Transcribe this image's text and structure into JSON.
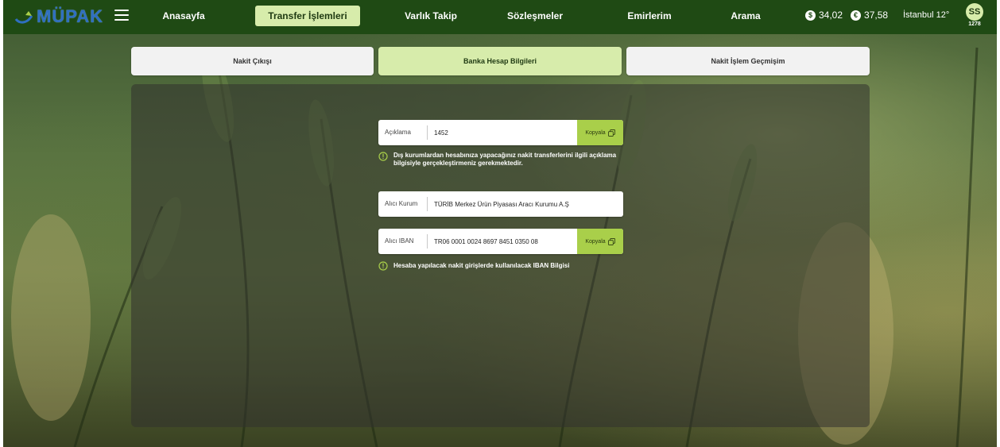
{
  "app": {
    "logo_text": "MÜPAK"
  },
  "nav": {
    "items": [
      {
        "label": "Anasayfa",
        "active": false
      },
      {
        "label": "Transfer İşlemleri",
        "active": true
      },
      {
        "label": "Varlık Takip",
        "active": false
      },
      {
        "label": "Sözleşmeler",
        "active": false
      },
      {
        "label": "Emirlerim",
        "active": false
      },
      {
        "label": "Arama",
        "active": false
      }
    ]
  },
  "rates": {
    "usd_symbol": "$",
    "usd": "34,02",
    "eur_symbol": "€",
    "eur": "37,58"
  },
  "weather": "İstanbul 12°",
  "user": {
    "initials": "SS",
    "id": "1278"
  },
  "tabs": [
    {
      "label": "Nakit Çıkışı",
      "active": false
    },
    {
      "label": "Banka Hesap Bilgileri",
      "active": true
    },
    {
      "label": "Nakit İşlem Geçmişim",
      "active": false
    }
  ],
  "form": {
    "description": {
      "label": "Açıklama",
      "value": "1452",
      "copy_label": "Kopyala"
    },
    "description_note": "Dış kurumlardan hesabınıza yapacağınız nakit transferlerini ilgili açıklama bilgisiyle gerçekleştirmeniz gerekmektedir.",
    "recipient": {
      "label": "Alıcı Kurum",
      "value": "TÜRİB Merkez Ürün Piyasası Aracı Kurumu A.Ş"
    },
    "iban": {
      "label": "Alıcı IBAN",
      "value": "TR06 0001 0024 8697 8451 0350 08",
      "copy_label": "Kopyala"
    },
    "iban_note": "Hesaba yapılacak nakit girişlerde kullanılacak IBAN Bilgisi"
  },
  "colors": {
    "topbar": "#1f4a14",
    "accent": "#d7ecab",
    "copy_button": "#a9cf4a",
    "logo": "#2f6fc0"
  }
}
